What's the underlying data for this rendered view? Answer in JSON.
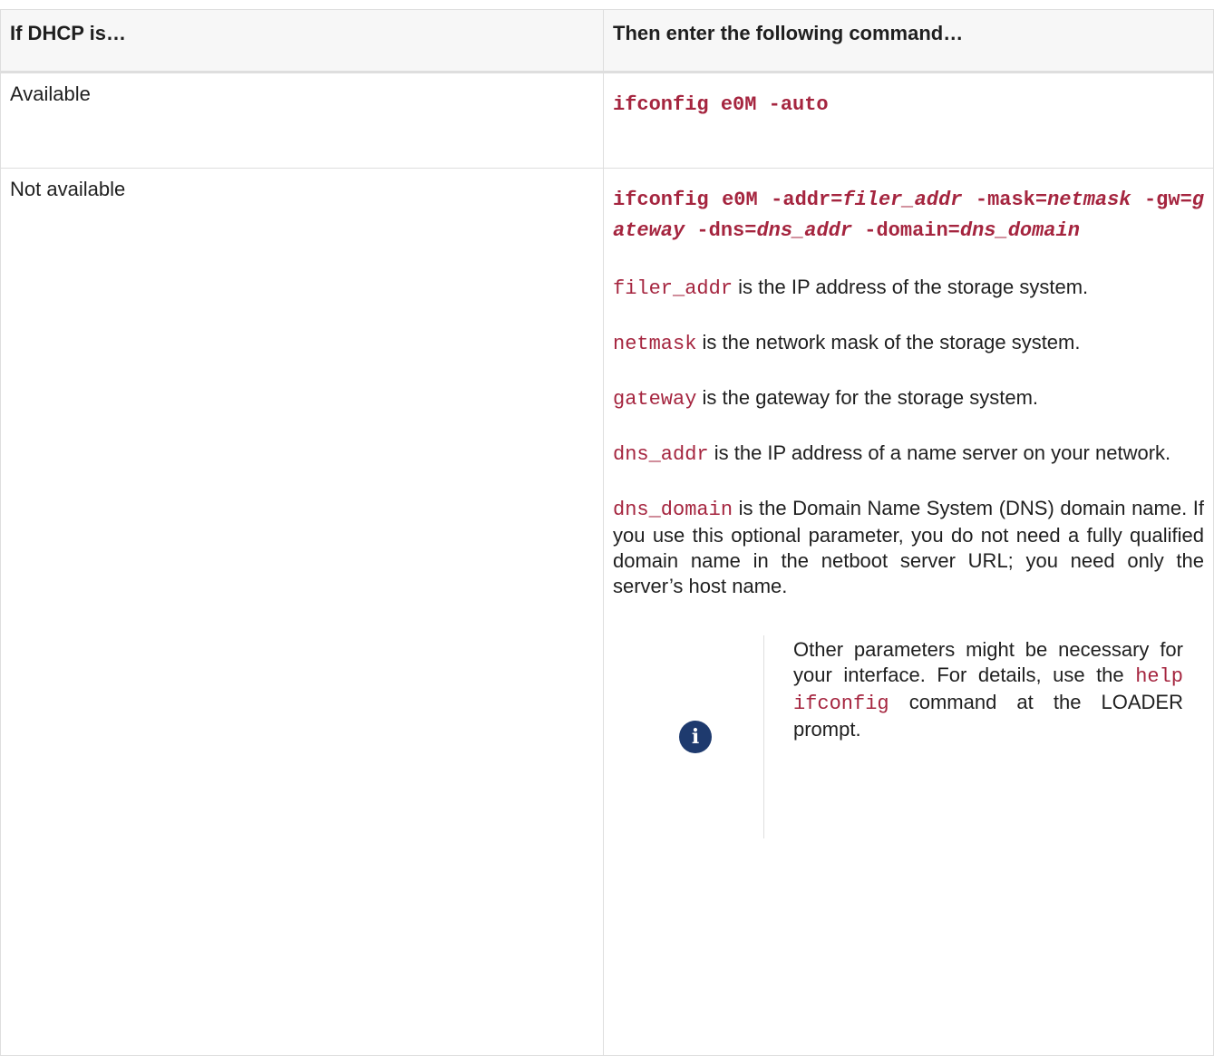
{
  "table": {
    "headers": {
      "col1": "If DHCP is…",
      "col2": "Then enter the following command…"
    },
    "row_available": {
      "label": "Available",
      "command": "ifconfig e0M -auto"
    },
    "row_not_available": {
      "label": "Not available",
      "command": {
        "part1": "ifconfig e0M -addr=",
        "arg1": "filer_addr",
        "part2": " -mask=",
        "arg2": "netmask",
        "part3": " -gw=",
        "arg3": "gateway",
        "part4": " -dns=",
        "arg4": "dns_addr",
        "part5": " -domain=",
        "arg5": "dns_domain"
      },
      "params": [
        {
          "code": "filer_addr",
          "text": " is the IP address of the storage system."
        },
        {
          "code": "netmask",
          "text": " is the network mask of the storage system."
        },
        {
          "code": "gateway",
          "text": " is the gateway for the storage system."
        },
        {
          "code": "dns_addr",
          "text": " is the IP address of a name server on your network."
        },
        {
          "code": "dns_domain",
          "text": " is the Domain Name System (DNS) domain name. If you use this optional parameter, you do not need a fully qualified domain name in the netboot server URL; you need only the server’s host name."
        }
      ],
      "note": {
        "icon": "info-icon",
        "text_before": "Other parameters might be necessary for your interface. For details, use the ",
        "code": "help ifconfig",
        "text_after": " command at the LOADER prompt."
      }
    }
  }
}
